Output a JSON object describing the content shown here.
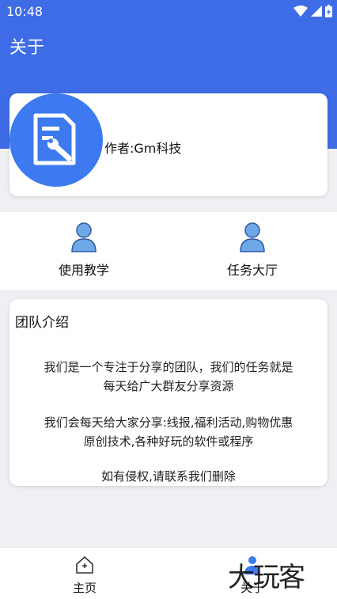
{
  "status_bar": {
    "time": "10:48"
  },
  "app_bar": {
    "title": "关于"
  },
  "author": {
    "text": "作者:Gm科技"
  },
  "menu": [
    {
      "label": "使用教学",
      "icon": "user-icon"
    },
    {
      "label": "任务大厅",
      "icon": "user-icon"
    }
  ],
  "team": {
    "title": "团队介绍",
    "para1_line1": "我们是一个专注于分享的团队，我们的任务就是",
    "para1_line2": "每天给广大群友分享资源",
    "para2_line1": "我们会每天给大家分享:线报,福利活动,购物优惠",
    "para2_line2": "原创技术,各种好玩的软件或程序",
    "para3_line1": "如有侵权,请联系我们删除"
  },
  "bottom_nav": {
    "home_label": "主页",
    "about_label": "关于"
  },
  "watermark": {
    "text": "大玩客"
  },
  "colors": {
    "primary": "#3d6ce6",
    "avatar": "#3d7af0",
    "user_icon": "#6fa8e8"
  }
}
